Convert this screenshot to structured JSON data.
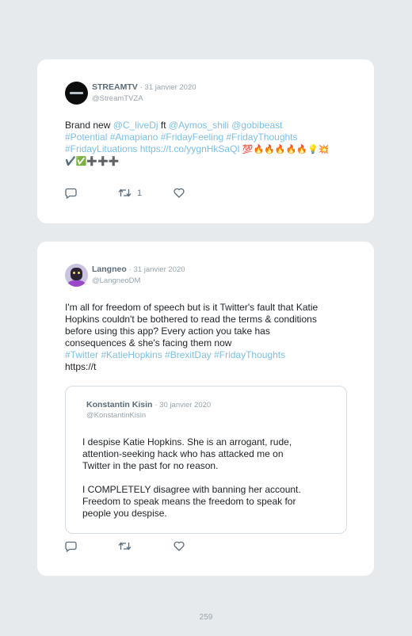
{
  "tweets": [
    {
      "name": "STREAMTV",
      "date": "· 31 janvier 2020",
      "handle": "@StreamTVZA",
      "text": {
        "l1a": "Brand new ",
        "l1b": "@C_liveDj",
        "l1c": " ft ",
        "l1d": "@Aymos_shili @gobibeast",
        "l2": "#Potential #Amapiano #FridayFeeling #FridayThoughts",
        "l3a": "#FridayLituations https://t.co/yygnHkSaQI",
        "l3b": " 💯🔥🔥🔥🔥🔥💡💥",
        "l4": "✔️✅➕➕➕"
      },
      "actions": {
        "reply_icon": "reply-icon",
        "retweet_icon": "retweet-icon",
        "retweet_count": "1",
        "like_icon": "heart-icon"
      }
    },
    {
      "name": "Langneo",
      "date": "· 31 janvier 2020",
      "handle": "@LangneoDM",
      "text": {
        "l1": "I'm all for freedom of speech but is it Twitter's fault that Katie",
        "l2": "Hopkins couldn't be bothered to read the terms & conditions",
        "l3": "before using this app? Every action you take has",
        "l4": "consequences & she's facing them now",
        "l5": "#Twitter #KatieHopkins #BrexitDay #FridayThoughts",
        "l6": "https://t"
      },
      "quote": {
        "name": "Konstantin Kisin",
        "date": "· 30 janvier 2020",
        "handle": "@KonstantinKisin",
        "p1": [
          "I despise Katie Hopkins. She is an arrogant, rude,",
          "attention-seeking hack who has attacked me on",
          "Twitter in the past for no reason."
        ],
        "p2": [
          "I COMPLETELY disagree with banning her account.",
          "Freedom to speak means the freedom to speak for",
          "people you despise."
        ]
      },
      "actions": {
        "reply_icon": "reply-icon",
        "retweet_icon": "retweet-icon",
        "like_icon": "heart-icon"
      }
    }
  ],
  "page_number": "259",
  "colors": {
    "link": "#7cbfe6",
    "background": "#e6eaed",
    "muted": "#98a4ae"
  }
}
